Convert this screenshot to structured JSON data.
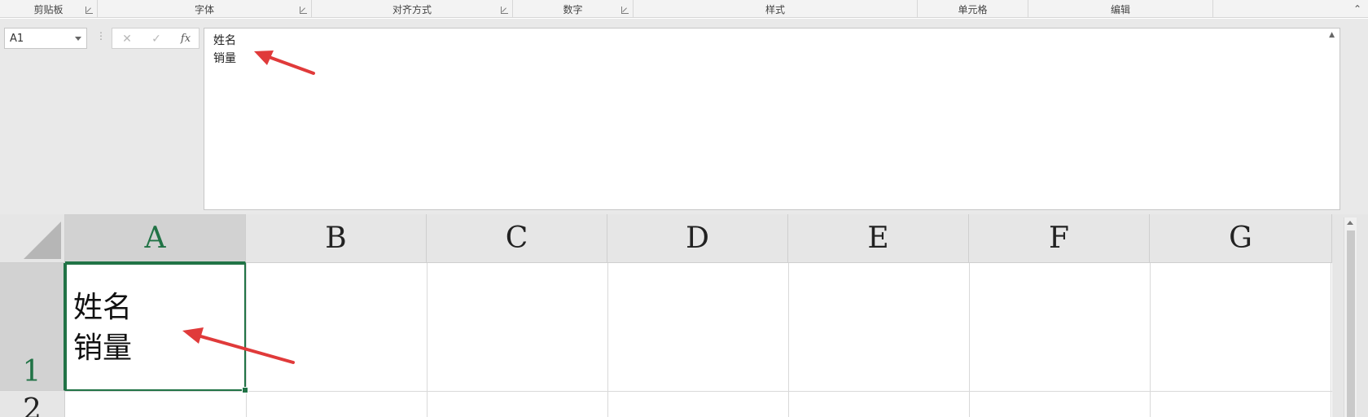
{
  "ribbon": {
    "groups": [
      {
        "label": "剪贴板",
        "launcher": true
      },
      {
        "label": "字体",
        "launcher": true
      },
      {
        "label": "对齐方式",
        "launcher": true
      },
      {
        "label": "数字",
        "launcher": true
      },
      {
        "label": "样式",
        "launcher": false
      },
      {
        "label": "单元格",
        "launcher": false
      },
      {
        "label": "编辑",
        "launcher": false
      }
    ],
    "collapse_icon": "chevron-up-icon"
  },
  "formula_bar": {
    "name_box": "A1",
    "cancel_glyph": "✕",
    "enter_glyph": "✓",
    "fx_label": "fx",
    "content_lines": [
      "姓名",
      "销量"
    ]
  },
  "sheet": {
    "columns": [
      "A",
      "B",
      "C",
      "D",
      "E",
      "F",
      "G"
    ],
    "rows": [
      "1",
      "2"
    ],
    "selected_cell": "A1",
    "cell_a1_lines": [
      "姓名",
      "销量"
    ]
  },
  "colors": {
    "accent": "#217346",
    "annotation_arrow": "#e03a3a"
  }
}
